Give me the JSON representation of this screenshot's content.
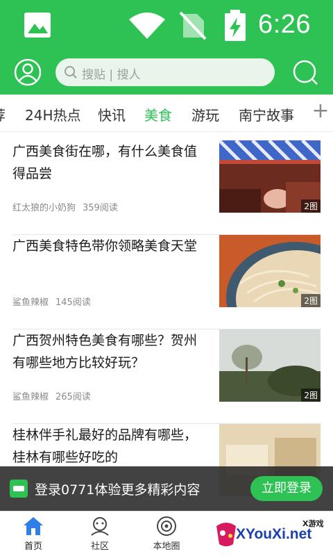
{
  "status_bar": {
    "time": "6:26",
    "icons": [
      "image-icon",
      "wifi-icon",
      "no-sim-icon",
      "battery-charging-icon"
    ]
  },
  "header": {
    "search_placeholder": "搜贴 | 搜人",
    "icons": [
      "avatar-icon",
      "search-icon"
    ]
  },
  "tabs": [
    {
      "label": "荐"
    },
    {
      "label": "24H热点"
    },
    {
      "label": "快讯"
    },
    {
      "label": "美食"
    },
    {
      "label": "游玩"
    },
    {
      "label": "南宁故事"
    }
  ],
  "active_tab": "美食",
  "tab_add_label": "+",
  "articles": [
    {
      "title": "广西美食街在哪，有什么美食值得品尝",
      "author": "红太狼的小奶狗",
      "reads": "359阅读",
      "img_count": "2图"
    },
    {
      "title": "广西美食特色带你领略美食天堂",
      "author": "鲨鱼辣椒",
      "reads": "145阅读",
      "img_count": "2图"
    },
    {
      "title": "广西贺州特色美食有哪些？贺州有哪些地方比较好玩？",
      "author": "鲨鱼辣椒",
      "reads": "265阅读",
      "img_count": "2图"
    },
    {
      "title": "桂林伴手礼最好的品牌有哪些，桂林有哪些好吃的",
      "author": "",
      "reads": "",
      "img_count": ""
    }
  ],
  "login_banner": {
    "message": "登录0771体验更多精彩内容",
    "button": "立即登录"
  },
  "bottom_nav": [
    {
      "label": "首页",
      "icon": "home-icon"
    },
    {
      "label": "社区",
      "icon": "community-icon"
    },
    {
      "label": "本地圈",
      "icon": "local-circle-icon"
    }
  ],
  "watermark": {
    "text": "XYouXi.net",
    "tag": "X游戏"
  },
  "colors": {
    "brand_green": "#2dc253",
    "text_dark": "#1a1a1a",
    "meta_gray": "#8a8a8a"
  }
}
